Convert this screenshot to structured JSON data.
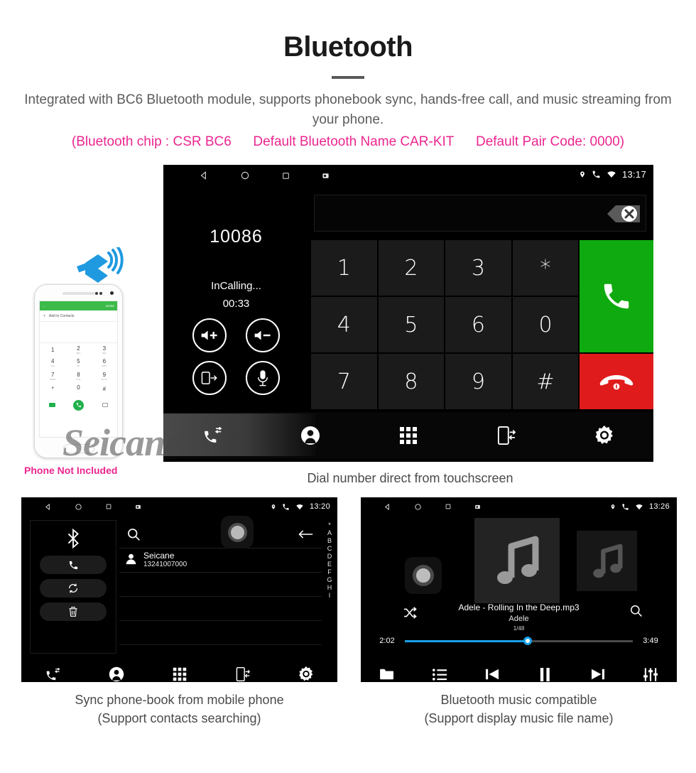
{
  "header": {
    "title": "Bluetooth",
    "description": "Integrated with BC6 Bluetooth module, supports phonebook sync, hands-free call, and music streaming from your phone.",
    "spec_chip": "(Bluetooth chip : CSR BC6",
    "spec_name": "Default Bluetooth Name CAR-KIT",
    "spec_pair": "Default Pair Code: 0000)",
    "accent_color": "#ec268f",
    "text_color": "#5c5c5c"
  },
  "dialer_screen": {
    "status_bar": {
      "time": "13:17",
      "nav_icons": [
        "back-triangle-icon",
        "home-circle-icon",
        "recents-square-icon",
        "screenshot-icon"
      ],
      "status_icons": [
        "location-pin-icon",
        "phone-icon",
        "wifi-icon"
      ]
    },
    "number": "10086",
    "call_state": "InCalling...",
    "call_timer": "00:33",
    "input_value": "",
    "call_controls": [
      {
        "name": "volume-up-button",
        "icon": "speaker-plus-icon"
      },
      {
        "name": "volume-down-button",
        "icon": "speaker-minus-icon"
      },
      {
        "name": "transfer-to-phone-button",
        "icon": "phone-transfer-icon"
      },
      {
        "name": "mute-mic-button",
        "icon": "microphone-icon"
      }
    ],
    "keys": [
      "1",
      "2",
      "3",
      "*",
      "4",
      "5",
      "6",
      "0",
      "7",
      "8",
      "9",
      "#"
    ],
    "call_button": "call-icon",
    "hangup_button": "hangup-icon",
    "call_button_color": "#0faa0f",
    "hangup_button_color": "#e01b1b",
    "nav_items": [
      {
        "name": "call-log-tab",
        "icon": "call-log-icon"
      },
      {
        "name": "contacts-tab",
        "icon": "contact-person-icon"
      },
      {
        "name": "keypad-tab",
        "icon": "keypad-grid-icon"
      },
      {
        "name": "phone-sync-tab",
        "icon": "phone-sync-icon"
      },
      {
        "name": "settings-tab",
        "icon": "gear-icon"
      }
    ],
    "watermark": "Seicane"
  },
  "phone_mock": {
    "appbar_back": "←",
    "appbar_more": "MORE",
    "add_contact": "Add to Contacts",
    "keys": [
      {
        "digit": "1",
        "sub": ""
      },
      {
        "digit": "2",
        "sub": "ABC"
      },
      {
        "digit": "3",
        "sub": "DEF"
      },
      {
        "digit": "4",
        "sub": "GHI"
      },
      {
        "digit": "5",
        "sub": "JKL"
      },
      {
        "digit": "6",
        "sub": "MNO"
      },
      {
        "digit": "7",
        "sub": "PQRS"
      },
      {
        "digit": "8",
        "sub": "TUV"
      },
      {
        "digit": "9",
        "sub": "WXYZ"
      },
      {
        "digit": "*",
        "sub": ""
      },
      {
        "digit": "0",
        "sub": "+"
      },
      {
        "digit": "#",
        "sub": ""
      }
    ],
    "note": "Phone Not Included"
  },
  "captions": {
    "main": "Dial number direct from touchscreen",
    "left_line1": "Sync phone-book from mobile phone",
    "left_line2": "(Support contacts searching)",
    "right_line1": "Bluetooth music compatible",
    "right_line2": "(Support display music file name)"
  },
  "phonebook_screen": {
    "status_bar": {
      "time": "13:20"
    },
    "side_buttons": [
      {
        "name": "bluetooth-status-icon",
        "icon": "bluetooth-icon"
      },
      {
        "name": "dial-button",
        "icon": "phone-icon"
      },
      {
        "name": "sync-contacts-button",
        "icon": "sync-icon"
      },
      {
        "name": "delete-contacts-button",
        "icon": "trash-icon"
      }
    ],
    "search_placeholder": "",
    "back_label": "back-arrow-icon",
    "contacts": [
      {
        "name": "Seicane",
        "number": "13241007000"
      }
    ],
    "empty_rows": 4,
    "alpha_index": [
      "*",
      "A",
      "B",
      "C",
      "D",
      "E",
      "F",
      "G",
      "H",
      "I"
    ],
    "nav_items": [
      {
        "name": "call-log-tab",
        "icon": "call-log-icon"
      },
      {
        "name": "contacts-tab",
        "icon": "contact-person-icon"
      },
      {
        "name": "keypad-tab",
        "icon": "keypad-grid-icon"
      },
      {
        "name": "phone-sync-tab",
        "icon": "phone-sync-icon"
      },
      {
        "name": "settings-tab",
        "icon": "gear-icon"
      }
    ]
  },
  "music_screen": {
    "status_bar": {
      "time": "13:26"
    },
    "track_title": "Adele - Rolling In the Deep.mp3",
    "artist": "Adele",
    "track_position": "1/48",
    "elapsed": "2:02",
    "duration": "3:49",
    "progress_percent": 54,
    "progress_color": "#19a0e8",
    "controls": [
      {
        "name": "browse-folder-button",
        "icon": "folder-icon"
      },
      {
        "name": "playlist-button",
        "icon": "list-icon"
      },
      {
        "name": "previous-track-button",
        "icon": "previous-icon"
      },
      {
        "name": "pause-button",
        "icon": "pause-icon"
      },
      {
        "name": "next-track-button",
        "icon": "next-icon"
      },
      {
        "name": "equalizer-button",
        "icon": "equalizer-icon"
      }
    ],
    "shuffle": "shuffle-icon",
    "search": "search-icon"
  }
}
